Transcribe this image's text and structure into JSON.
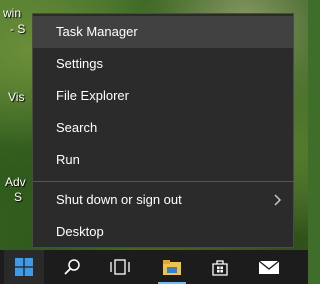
{
  "desktop": {
    "fragments": [
      "win",
      "- S",
      "Vis",
      "Adv",
      "S"
    ]
  },
  "menu": {
    "items": [
      {
        "label": "Task Manager"
      },
      {
        "label": "Settings"
      },
      {
        "label": "File Explorer"
      },
      {
        "label": "Search"
      },
      {
        "label": "Run"
      },
      {
        "label": "Shut down or sign out"
      },
      {
        "label": "Desktop"
      }
    ]
  },
  "taskbar": {
    "icons": [
      "windows-start-icon",
      "search-icon",
      "task-view-icon",
      "file-explorer-icon",
      "store-icon",
      "mail-icon"
    ]
  },
  "colors": {
    "menu_bg": "#2b2b2b",
    "hover_bg": "#414141",
    "taskbar_bg": "#1c1c1c",
    "accent": "#76b9ed"
  }
}
